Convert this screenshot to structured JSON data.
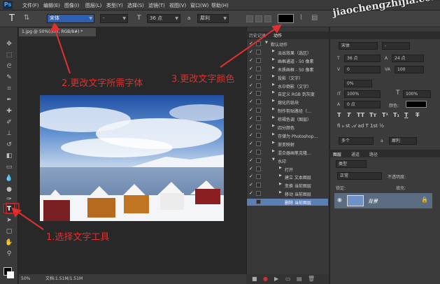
{
  "app": {
    "logo": "Ps"
  },
  "menu": [
    "文件(F)",
    "编辑(E)",
    "图像(I)",
    "图层(L)",
    "类型(Y)",
    "选择(S)",
    "滤镜(T)",
    "视图(V)",
    "窗口(W)",
    "帮助(H)"
  ],
  "options": {
    "tool_icon": "T",
    "font_family": "宋体",
    "font_style": "-",
    "font_size": "36 点",
    "aa_label": "a",
    "aa_mode": "犀利",
    "color": "#000000"
  },
  "document": {
    "tab": "1.jpg @ 50%(水印, RGB/8#) *",
    "zoom": "50%",
    "status": "文档:1.51M/1.51M"
  },
  "panels": {
    "tabs": [
      "历史记录",
      "动作"
    ],
    "actions": [
      {
        "check": "✓",
        "indent": 0,
        "expand": "▼",
        "label": "默认动作"
      },
      {
        "check": "✓",
        "indent": 1,
        "expand": "▶",
        "label": "淡出效果（选区）"
      },
      {
        "check": "✓",
        "indent": 1,
        "expand": "▶",
        "label": "画框通道 - 50 像素"
      },
      {
        "check": "✓",
        "indent": 1,
        "expand": "▶",
        "label": "木质画框 - 50 像素"
      },
      {
        "check": "✓",
        "indent": 1,
        "expand": "▶",
        "label": "投影（文字）"
      },
      {
        "check": "✓",
        "indent": 1,
        "expand": "▶",
        "label": "水中倒影（文字）"
      },
      {
        "check": "✓",
        "indent": 1,
        "expand": "▶",
        "label": "自定义 RGB 到灰度"
      },
      {
        "check": "✓",
        "indent": 1,
        "expand": "▶",
        "label": "熔化的铅块"
      },
      {
        "check": "✓",
        "indent": 1,
        "expand": "▶",
        "label": "制作剪贴路径（…"
      },
      {
        "check": "✓",
        "indent": 1,
        "expand": "▶",
        "label": "棕褐色调（图层）"
      },
      {
        "check": "✓",
        "indent": 1,
        "expand": "▶",
        "label": "四分颜色"
      },
      {
        "check": "✓",
        "indent": 1,
        "expand": "▶",
        "label": "存储为 Photoshop…"
      },
      {
        "check": "✓",
        "indent": 1,
        "expand": "▶",
        "label": "渐变映射"
      },
      {
        "check": "✓",
        "indent": 1,
        "expand": "▶",
        "label": "混合器画笔克隆…"
      },
      {
        "check": "✓",
        "indent": 1,
        "expand": "▼",
        "label": "水印"
      },
      {
        "check": "✓",
        "indent": 2,
        "expand": "▶",
        "label": "打开"
      },
      {
        "check": "✓",
        "indent": 2,
        "expand": "▶",
        "label": "建立 文本图层"
      },
      {
        "check": "✓",
        "indent": 2,
        "expand": "▶",
        "label": "变换 当前图层"
      },
      {
        "check": "✓",
        "indent": 2,
        "expand": "▶",
        "label": "移动 当前图层"
      },
      {
        "check": "",
        "indent": 2,
        "expand": "",
        "label": "删除 当前图层",
        "selected": true
      }
    ]
  },
  "character": {
    "font_family": "宋体",
    "font_style": "-",
    "size": "36 点",
    "leading": "24 点",
    "kerning": "0",
    "tracking": "100",
    "tracking_label": "VA",
    "vscale_label": "100%",
    "hscale": "100%",
    "percent": "0%",
    "baseline": "0 点",
    "color_label": "颜色:",
    "lang": "多个",
    "aa": "犀利",
    "aa_label": "a"
  },
  "layers": {
    "tabs": [
      "图层",
      "通道",
      "路径"
    ],
    "kind": "类型",
    "blend": "正常",
    "opacity_label": "不透明度:",
    "lock_label": "锁定:",
    "fill_label": "填充:",
    "layer_name": "背景"
  },
  "annotations": {
    "step1": "1.选择文字工具",
    "step2": "2.更改文字所需字体",
    "step3": "3.更改文字颜色"
  },
  "watermark": "jiaochengzhijia.com 教程之家",
  "colors": {
    "annotation": "#e03030",
    "font_highlight": "#2f5fb0"
  }
}
